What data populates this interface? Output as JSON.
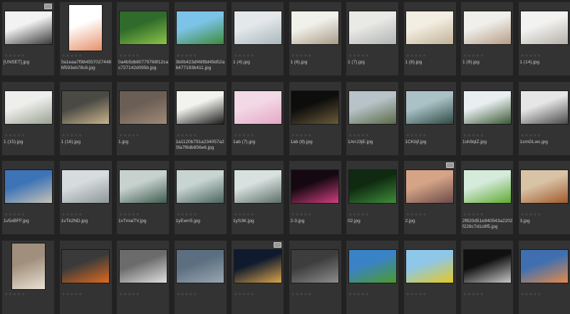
{
  "colors": {
    "background": "#222222",
    "cell": "#333333",
    "label": "#c8c8c8",
    "star": "#4a4a4a"
  },
  "rating_glyphs": "★★★★★",
  "thumbnails": [
    {
      "filename": "[UNSET].jpg",
      "flagged": true,
      "orientation": "landscape",
      "image": "blurred-portrait",
      "colors": [
        "#f2f2f2",
        "#3a3a3a"
      ]
    },
    {
      "filename": "0a1eaa7f984557027448 6f593eb78c6.jpg",
      "flagged": false,
      "orientation": "portrait",
      "image": "woman-in-coral-dress",
      "colors": [
        "#ffffff",
        "#e8906a"
      ]
    },
    {
      "filename": "0a4b5db80779768f12cac727142d095b.jpg",
      "flagged": false,
      "orientation": "landscape",
      "image": "green-moss-branch",
      "colors": [
        "#2f6b2a",
        "#8dc34a"
      ]
    },
    {
      "filename": "0b0b423df48f8d49d52a6477193b411.jpg",
      "flagged": false,
      "orientation": "landscape",
      "image": "red-poppy-field",
      "colors": [
        "#7cc3e8",
        "#3e8a3a"
      ]
    },
    {
      "filename": "1 (4).jpg",
      "flagged": false,
      "orientation": "landscape",
      "image": "sheer-curtains",
      "colors": [
        "#e4e8ea",
        "#a9b7bd"
      ]
    },
    {
      "filename": "1 (6).jpg",
      "flagged": false,
      "orientation": "landscape",
      "image": "bright-room-with-table",
      "colors": [
        "#f1f1ec",
        "#a99b86"
      ]
    },
    {
      "filename": "1 (7).jpg",
      "flagged": false,
      "orientation": "landscape",
      "image": "empty-room-window",
      "colors": [
        "#e9e9e6",
        "#b0b4b3"
      ]
    },
    {
      "filename": "1 (8).jpg",
      "flagged": false,
      "orientation": "landscape",
      "image": "sunlit-room",
      "colors": [
        "#f3eee2",
        "#c0b296"
      ]
    },
    {
      "filename": "1 (9).jpg",
      "flagged": false,
      "orientation": "landscape",
      "image": "loft-windows",
      "colors": [
        "#f0efec",
        "#b69d86"
      ]
    },
    {
      "filename": "1 (14).jpg",
      "flagged": false,
      "orientation": "landscape",
      "image": "white-interior",
      "colors": [
        "#f2f2f0",
        "#b5b0a8"
      ]
    },
    {
      "filename": "1 (15).jpg",
      "flagged": false,
      "orientation": "landscape",
      "image": "room-corner-plant",
      "colors": [
        "#eeeeec",
        "#9aa293"
      ]
    },
    {
      "filename": "1 (16).jpg",
      "flagged": false,
      "orientation": "landscape",
      "image": "window-shadows",
      "colors": [
        "#4a4944",
        "#c9b48d"
      ]
    },
    {
      "filename": "1.jpg",
      "flagged": false,
      "orientation": "landscape",
      "image": "pebbles",
      "colors": [
        "#6b5e55",
        "#a08a78"
      ]
    },
    {
      "filename": "1a1120b791a234057a20fa7f6db856e6.jpg",
      "flagged": false,
      "orientation": "landscape",
      "image": "balanced-black-stones",
      "colors": [
        "#f2f2ee",
        "#1c1c1c"
      ]
    },
    {
      "filename": "1ab (7).jpg",
      "flagged": false,
      "orientation": "landscape",
      "image": "pink-hearts",
      "colors": [
        "#f3d9e6",
        "#e4a8c6"
      ]
    },
    {
      "filename": "1ab (8).jpg",
      "flagged": false,
      "orientation": "landscape",
      "image": "dark-figure",
      "colors": [
        "#0d0d0c",
        "#6a5a3a"
      ]
    },
    {
      "filename": "1ArrJ3jE.jpg",
      "flagged": false,
      "orientation": "landscape",
      "image": "valley-village",
      "colors": [
        "#b7c3c8",
        "#5b6a48"
      ]
    },
    {
      "filename": "1CKbjf.jpg",
      "flagged": false,
      "orientation": "landscape",
      "image": "misty-pine-forest",
      "colors": [
        "#aac2c6",
        "#2f4a46"
      ]
    },
    {
      "filename": "1sh9qIZ.jpg",
      "flagged": false,
      "orientation": "landscape",
      "image": "road-through-trees",
      "colors": [
        "#e9eef0",
        "#3a5a34"
      ]
    },
    {
      "filename": "1smGLws.jpg",
      "flagged": false,
      "orientation": "landscape",
      "image": "foggy-road",
      "colors": [
        "#e6e6e6",
        "#4a4a4a"
      ]
    },
    {
      "filename": "1v5xBFF.jpg",
      "flagged": false,
      "orientation": "landscape",
      "image": "blue-sky-road",
      "colors": [
        "#3d74b8",
        "#c8c2b4"
      ]
    },
    {
      "filename": "1vTk2ND.jpg",
      "flagged": false,
      "orientation": "landscape",
      "image": "winter-fog-road",
      "colors": [
        "#d6dcde",
        "#8e9698"
      ]
    },
    {
      "filename": "1vTmaiTV.jpg",
      "flagged": false,
      "orientation": "landscape",
      "image": "misty-forest-green",
      "colors": [
        "#c7d2cf",
        "#3f5c50"
      ]
    },
    {
      "filename": "1yEwrr5.jpg",
      "flagged": false,
      "orientation": "landscape",
      "image": "foggy-pines",
      "colors": [
        "#c7d4d2",
        "#4b645f"
      ]
    },
    {
      "filename": "1yS3K.jpg",
      "flagged": false,
      "orientation": "landscape",
      "image": "fog-road-trees",
      "colors": [
        "#d8e0e0",
        "#5d6e66"
      ]
    },
    {
      "filename": "2-3.jpg",
      "flagged": false,
      "orientation": "landscape",
      "image": "pink-flowers-dark",
      "colors": [
        "#150811",
        "#d0407f"
      ]
    },
    {
      "filename": "02.jpg",
      "flagged": false,
      "orientation": "landscape",
      "image": "hand-with-card",
      "colors": [
        "#0f2a10",
        "#3f8d3b"
      ]
    },
    {
      "filename": "2.jpg",
      "flagged": true,
      "orientation": "landscape",
      "image": "desert-road-sunset",
      "colors": [
        "#d5a487",
        "#6a4a48"
      ]
    },
    {
      "filename": "2f620d51e940543a2202f228c7d1c8f5.jpg",
      "flagged": false,
      "orientation": "landscape",
      "image": "green-sprout",
      "colors": [
        "#d4eadb",
        "#5faa2f"
      ]
    },
    {
      "filename": "3.jpg",
      "flagged": false,
      "orientation": "landscape",
      "image": "autumn-road",
      "colors": [
        "#d9c3a7",
        "#a05a2a"
      ]
    },
    {
      "filename": "",
      "flagged": false,
      "orientation": "portrait",
      "image": "candles",
      "colors": [
        "#a08f7c",
        "#e9e0d3"
      ]
    },
    {
      "filename": "",
      "flagged": false,
      "orientation": "landscape",
      "image": "orange-flowers",
      "colors": [
        "#3a3a3a",
        "#e06a20"
      ]
    },
    {
      "filename": "",
      "flagged": false,
      "orientation": "landscape",
      "image": "snowy-mountains",
      "colors": [
        "#6b6b6b",
        "#e0e0e0"
      ]
    },
    {
      "filename": "",
      "flagged": false,
      "orientation": "landscape",
      "image": "stairs-street",
      "colors": [
        "#5b6f80",
        "#9aa6b0"
      ]
    },
    {
      "filename": "",
      "flagged": true,
      "orientation": "landscape",
      "image": "night-lights",
      "colors": [
        "#0f1a2e",
        "#d9a44a"
      ]
    },
    {
      "filename": "",
      "flagged": false,
      "orientation": "landscape",
      "image": "industrial-hall",
      "colors": [
        "#3d3d3d",
        "#8c8c8c"
      ]
    },
    {
      "filename": "",
      "flagged": false,
      "orientation": "landscape",
      "image": "green-meadow-clouds",
      "colors": [
        "#3a82c6",
        "#4c9a2a"
      ]
    },
    {
      "filename": "",
      "flagged": false,
      "orientation": "landscape",
      "image": "dandelions",
      "colors": [
        "#8ec7e8",
        "#e6c923"
      ]
    },
    {
      "filename": "",
      "flagged": false,
      "orientation": "landscape",
      "image": "white-car",
      "colors": [
        "#101010",
        "#c8c8c8"
      ]
    },
    {
      "filename": "",
      "flagged": false,
      "orientation": "landscape",
      "image": "sunset-clouds",
      "colors": [
        "#3f6fb0",
        "#e48a4a"
      ]
    }
  ]
}
